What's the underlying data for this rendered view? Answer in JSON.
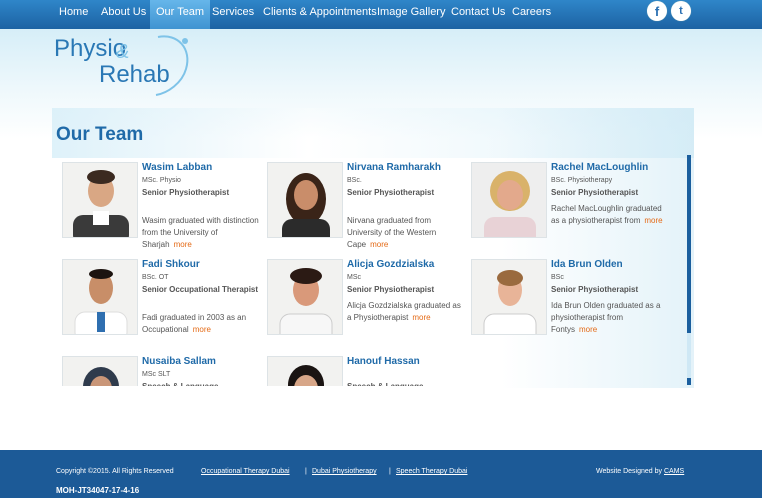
{
  "nav": {
    "items": [
      "Home",
      "About Us",
      "Our Team",
      "Services",
      "Clients & Appointments",
      "Image Gallery",
      "Contact Us",
      "Careers"
    ],
    "active": "Our Team",
    "social": [
      "facebook-icon",
      "twitter-icon"
    ]
  },
  "logo": {
    "line1": "Physio",
    "amp": "&",
    "line2": "Rehab"
  },
  "page_title": "Our Team",
  "team": [
    {
      "name": "Wasim Labban",
      "degree": "MSc. Physio",
      "role": "Senior Physiotherapist",
      "bio": "Wasim graduated with distinction from the University of Sharjah"
    },
    {
      "name": "Nirvana Ramharakh",
      "degree": "BSc.",
      "role": "Senior Physiotherapist",
      "bio": "Nirvana graduated from University of the Western Cape"
    },
    {
      "name": "Rachel MacLoughlin",
      "degree": "BSc. Physiotherapy",
      "role": "Senior Physiotherapist",
      "bio": "Rachel MacLoughlin graduated as a physiotherapist from"
    },
    {
      "name": "Fadi Shkour",
      "degree": "BSc. OT",
      "role": "Senior Occupational Therapist",
      "bio": "Fadi graduated in 2003 as an Occupational"
    },
    {
      "name": "Alicja Gozdzialska",
      "degree": "MSc",
      "role": "Senior Physiotherapist",
      "bio": "Alicja Gozdzialska graduated as a Physiotherapist"
    },
    {
      "name": "Ida Brun Olden",
      "degree": "BSc",
      "role": "Senior Physiotherapist",
      "bio": "Ida Brun Olden graduated as a physiotherapist from Fontys"
    },
    {
      "name": "Nusaiba Sallam",
      "degree": "MSc SLT",
      "role": "Speech & Language",
      "bio": ""
    },
    {
      "name": "Hanouf Hassan",
      "degree": "",
      "role": "Speech & Language",
      "bio": ""
    }
  ],
  "more_label": "more",
  "footer": {
    "copyright": "Copyright ©2015. All Rights Reserved",
    "links": [
      "Occupational Therapy Dubai",
      "Dubai Physiotherapy",
      "Speech Therapy Dubai"
    ],
    "separator": "|",
    "designed_by": "Website Designed by",
    "designer": "CAMS",
    "moh": "MOH-JT34047-17-4-16"
  }
}
